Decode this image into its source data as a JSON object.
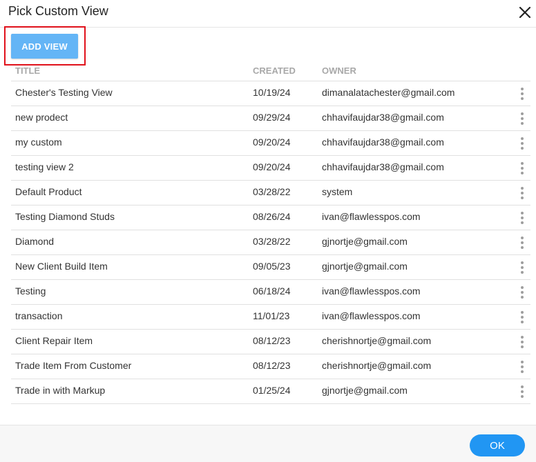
{
  "dialog": {
    "title": "Pick Custom View",
    "add_button_label": "ADD VIEW",
    "ok_button_label": "OK"
  },
  "table": {
    "headers": {
      "title": "TITLE",
      "created": "CREATED",
      "owner": "OWNER"
    },
    "rows": [
      {
        "title": "Chester's Testing View",
        "created": "10/19/24",
        "owner": "dimanalatachester@gmail.com"
      },
      {
        "title": "new prodect",
        "created": "09/29/24",
        "owner": "chhavifaujdar38@gmail.com"
      },
      {
        "title": "my custom",
        "created": "09/20/24",
        "owner": "chhavifaujdar38@gmail.com"
      },
      {
        "title": "testing view 2",
        "created": "09/20/24",
        "owner": "chhavifaujdar38@gmail.com"
      },
      {
        "title": "Default Product",
        "created": "03/28/22",
        "owner": "system"
      },
      {
        "title": "Testing Diamond Studs",
        "created": "08/26/24",
        "owner": "ivan@flawlesspos.com"
      },
      {
        "title": "Diamond",
        "created": "03/28/22",
        "owner": "gjnortje@gmail.com"
      },
      {
        "title": "New Client Build Item",
        "created": "09/05/23",
        "owner": "gjnortje@gmail.com"
      },
      {
        "title": "Testing",
        "created": "06/18/24",
        "owner": "ivan@flawlesspos.com"
      },
      {
        "title": "transaction",
        "created": "11/01/23",
        "owner": "ivan@flawlesspos.com"
      },
      {
        "title": "Client Repair Item",
        "created": "08/12/23",
        "owner": "cherishnortje@gmail.com"
      },
      {
        "title": "Trade Item From Customer",
        "created": "08/12/23",
        "owner": "cherishnortje@gmail.com"
      },
      {
        "title": "Trade in with Markup",
        "created": "01/25/24",
        "owner": "gjnortje@gmail.com"
      }
    ]
  },
  "icons": {
    "close": "close-icon",
    "row_menu": "more-vertical-icon"
  },
  "colors": {
    "add_button": "#64b5f6",
    "ok_button": "#2196f3",
    "highlight_box": "#e0101a"
  }
}
